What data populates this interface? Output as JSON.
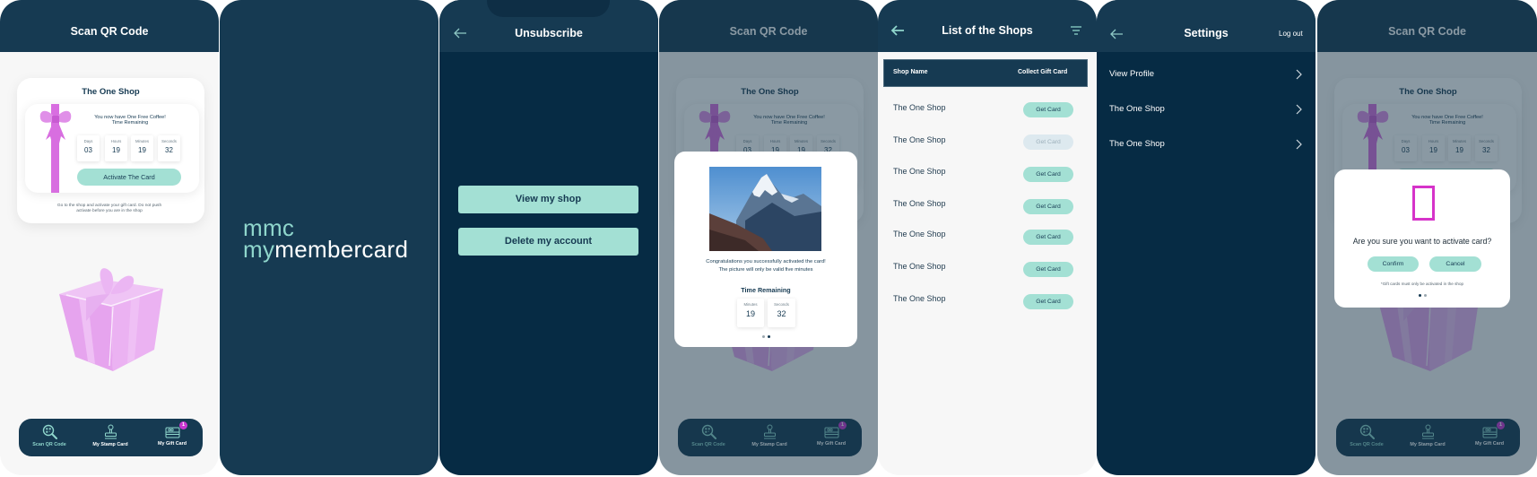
{
  "scan_screen": {
    "header_title": "Scan QR Code",
    "shop_name": "The One Shop",
    "message_line1": "You now have One Free Coffee!",
    "message_line2": "Time Remaining",
    "timer": [
      {
        "label": "Days",
        "value": "03"
      },
      {
        "label": "Hours",
        "value": "19"
      },
      {
        "label": "Minutes",
        "value": "19"
      },
      {
        "label": "Seconds",
        "value": "32"
      }
    ],
    "activate_label": "Activate The Card",
    "footer_line1": "Go to the shop and activate your gift card. Do not push",
    "footer_line2": "activate before you are in the shop",
    "nav": [
      {
        "label": "Scan QR Code",
        "icon": "qr-search-icon",
        "active": true
      },
      {
        "label": "My Stamp Card",
        "icon": "stamp-icon",
        "active": false
      },
      {
        "label": "My Gift Card",
        "icon": "gift-card-icon",
        "active": false,
        "badge": "1"
      }
    ]
  },
  "splash": {
    "logo_short": "mmc",
    "logo_my": "my",
    "logo_rest": "membercard"
  },
  "unsubscribe": {
    "title": "Unsubscribe",
    "view_shop_label": "View my shop",
    "delete_account_label": "Delete my account"
  },
  "activated_modal": {
    "image_icon": "mountain-photo",
    "line1": "Congratulations you successfully activated the card!",
    "line2": "The picture will only be valid five minutes",
    "time_title": "Time Remaining",
    "timer": [
      {
        "label": "Minutes",
        "value": "19"
      },
      {
        "label": "Seconds",
        "value": "32"
      }
    ],
    "pager": {
      "pages": 2,
      "current": 2
    }
  },
  "shops": {
    "title": "List of the Shops",
    "columns": [
      "Shop Name",
      "Collect Gift Card"
    ],
    "rows": [
      {
        "name": "The One Shop",
        "action": "Get Card",
        "enabled": true
      },
      {
        "name": "The One Shop",
        "action": "Get Card",
        "enabled": false
      },
      {
        "name": "The One Shop",
        "action": "Get Card",
        "enabled": true
      },
      {
        "name": "The One Shop",
        "action": "Get Card",
        "enabled": true
      },
      {
        "name": "The One Shop",
        "action": "Get Card",
        "enabled": true
      },
      {
        "name": "The One Shop",
        "action": "Get Card",
        "enabled": true
      },
      {
        "name": "The One Shop",
        "action": "Get Card",
        "enabled": true
      }
    ]
  },
  "settings": {
    "title": "Settings",
    "logout_label": "Log out",
    "items": [
      "View Profile",
      "The One Shop",
      "The One Shop"
    ]
  },
  "confirm_modal": {
    "question": "Are you sure you want to activate card?",
    "confirm_label": "Confirm",
    "cancel_label": "Cancel",
    "note": "*Gift cards must only be activated in the shop",
    "pager": {
      "pages": 2,
      "current": 1
    }
  },
  "colors": {
    "header": "#163a52",
    "dark_body": "#062b44",
    "accent_teal": "#a3e0d4",
    "logo_teal": "#8fd6cc",
    "ribbon_pink": "#d86ee0",
    "badge_magenta": "#c936d0"
  }
}
